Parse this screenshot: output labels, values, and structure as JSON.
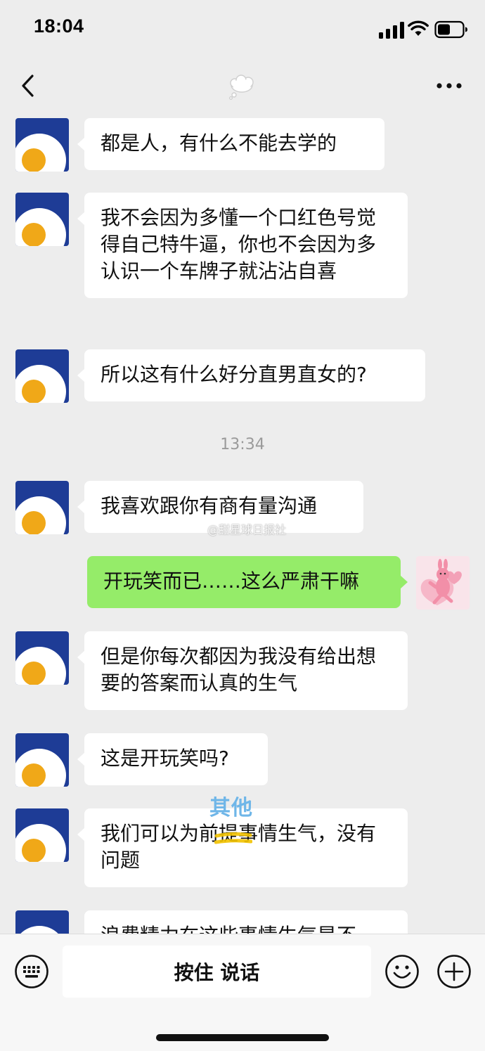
{
  "status_bar": {
    "time": "18:04"
  },
  "nav": {
    "title_icon": "thought-bubble-emoji"
  },
  "messages": [
    {
      "side": "left",
      "text": "都是人，有什么不能去学的"
    },
    {
      "side": "left",
      "text": "我不会因为多懂一个口红色号觉得自己特牛逼，你也不会因为多认识一个车牌子就沾沾自喜"
    },
    {
      "side": "left",
      "text": "所以这有什么好分直男直女的?"
    },
    {
      "side": "left",
      "text": "我喜欢跟你有商有量沟通"
    },
    {
      "side": "right",
      "text": "开玩笑而已……这么严肃干嘛"
    },
    {
      "side": "left",
      "text": "但是你每次都因为我没有给出想要的答案而认真的生气"
    },
    {
      "side": "left",
      "text": "这是开玩笑吗?"
    },
    {
      "side": "left",
      "text": "我们可以为前提事情生气，没有问题"
    },
    {
      "side": "left",
      "text": "浪费精力在这些事情生气是不"
    }
  ],
  "timestamp": "13:34",
  "watermark": "@甜星球日报社",
  "overlay_sticker_text": "其他",
  "input_bar": {
    "hold_to_talk_label": "按住 说话"
  },
  "colors": {
    "background": "#ededed",
    "bubble_self": "#95ec69",
    "bubble_other": "#ffffff",
    "avatar_blue": "#1e3c96",
    "avatar_yolk": "#f0a818"
  }
}
